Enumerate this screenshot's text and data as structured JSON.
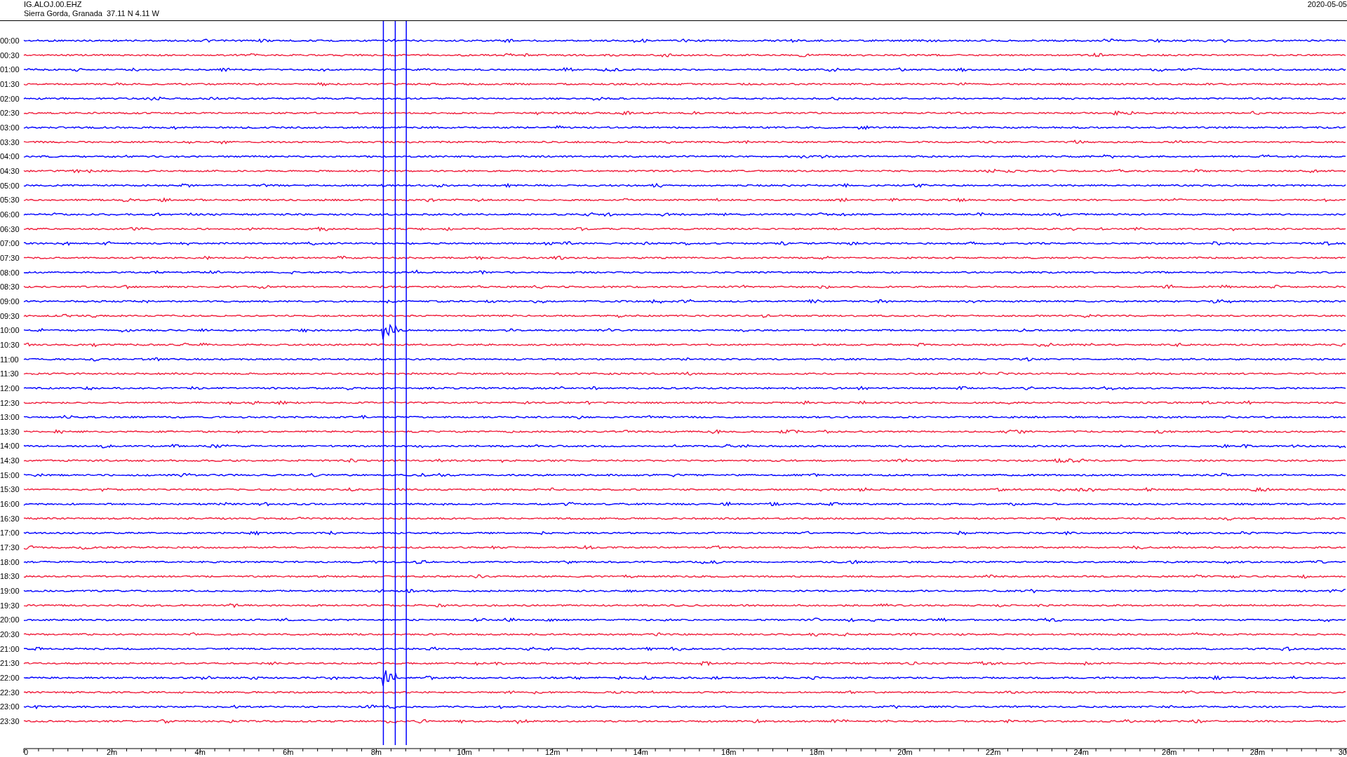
{
  "header": {
    "station": "IG.ALOJ.00.EHZ",
    "location": "Sierra Gorda, Granada  37.11 N 4.11 W",
    "date": "2020-05-05"
  },
  "rows": [
    {
      "label": "00:00",
      "color": "#0000ff"
    },
    {
      "label": "00:30",
      "color": "#f01e3c"
    },
    {
      "label": "01:00",
      "color": "#0000ff"
    },
    {
      "label": "01:30",
      "color": "#f01e3c"
    },
    {
      "label": "02:00",
      "color": "#0000ff"
    },
    {
      "label": "02:30",
      "color": "#f01e3c"
    },
    {
      "label": "03:00",
      "color": "#0000ff"
    },
    {
      "label": "03:30",
      "color": "#f01e3c"
    },
    {
      "label": "04:00",
      "color": "#0000ff"
    },
    {
      "label": "04:30",
      "color": "#f01e3c"
    },
    {
      "label": "05:00",
      "color": "#0000ff"
    },
    {
      "label": "05:30",
      "color": "#f01e3c"
    },
    {
      "label": "06:00",
      "color": "#0000ff"
    },
    {
      "label": "06:30",
      "color": "#f01e3c"
    },
    {
      "label": "07:00",
      "color": "#0000ff"
    },
    {
      "label": "07:30",
      "color": "#f01e3c"
    },
    {
      "label": "08:00",
      "color": "#0000ff"
    },
    {
      "label": "08:30",
      "color": "#f01e3c"
    },
    {
      "label": "09:00",
      "color": "#0000ff"
    },
    {
      "label": "09:30",
      "color": "#f01e3c"
    },
    {
      "label": "10:00",
      "color": "#0000ff"
    },
    {
      "label": "10:30",
      "color": "#f01e3c"
    },
    {
      "label": "11:00",
      "color": "#0000ff"
    },
    {
      "label": "11:30",
      "color": "#f01e3c"
    },
    {
      "label": "12:00",
      "color": "#0000ff"
    },
    {
      "label": "12:30",
      "color": "#f01e3c"
    },
    {
      "label": "13:00",
      "color": "#0000ff"
    },
    {
      "label": "13:30",
      "color": "#f01e3c"
    },
    {
      "label": "14:00",
      "color": "#0000ff"
    },
    {
      "label": "14:30",
      "color": "#f01e3c"
    },
    {
      "label": "15:00",
      "color": "#0000ff"
    },
    {
      "label": "15:30",
      "color": "#f01e3c"
    },
    {
      "label": "16:00",
      "color": "#0000ff"
    },
    {
      "label": "16:30",
      "color": "#f01e3c"
    },
    {
      "label": "17:00",
      "color": "#0000ff"
    },
    {
      "label": "17:30",
      "color": "#f01e3c"
    },
    {
      "label": "18:00",
      "color": "#0000ff"
    },
    {
      "label": "18:30",
      "color": "#f01e3c"
    },
    {
      "label": "19:00",
      "color": "#0000ff"
    },
    {
      "label": "19:30",
      "color": "#f01e3c"
    },
    {
      "label": "20:00",
      "color": "#0000ff"
    },
    {
      "label": "20:30",
      "color": "#f01e3c"
    },
    {
      "label": "21:00",
      "color": "#0000ff"
    },
    {
      "label": "21:30",
      "color": "#f01e3c"
    },
    {
      "label": "22:00",
      "color": "#0000ff"
    },
    {
      "label": "22:30",
      "color": "#f01e3c"
    },
    {
      "label": "23:00",
      "color": "#0000ff"
    },
    {
      "label": "23:30",
      "color": "#f01e3c"
    }
  ],
  "x_axis": {
    "labels": [
      "0",
      "2m",
      "4m",
      "6m",
      "8m",
      "10m",
      "12m",
      "14m",
      "16m",
      "18m",
      "20m",
      "22m",
      "24m",
      "26m",
      "28m",
      "30"
    ]
  }
}
